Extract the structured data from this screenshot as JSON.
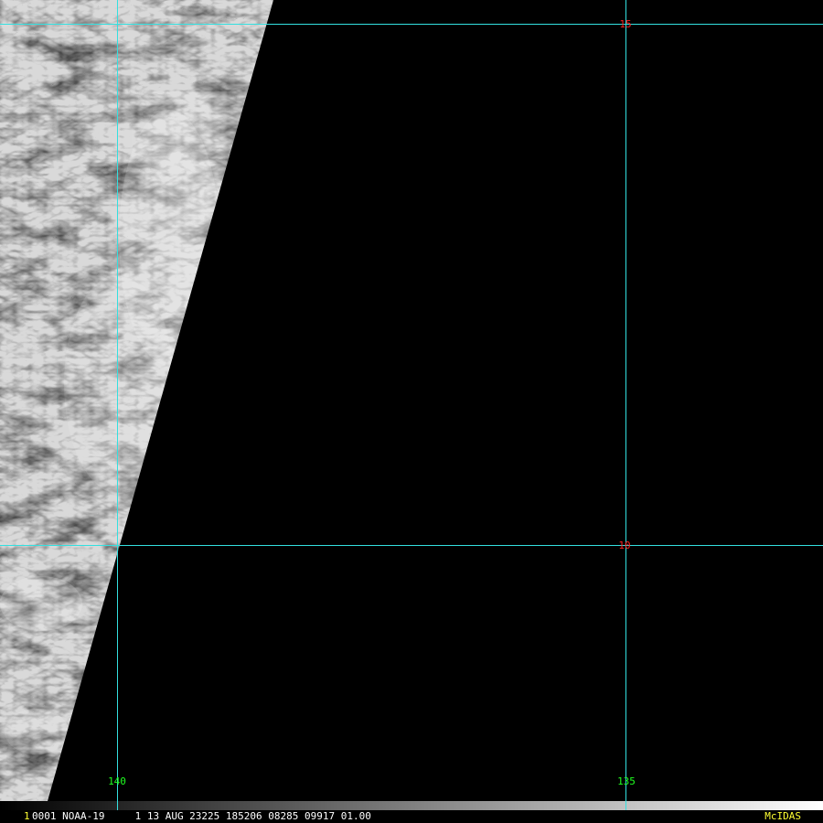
{
  "satellite_image": {
    "description_name": "cloud-imagery",
    "colors": {
      "background": "#000000",
      "gridline": "#33e0e0",
      "lat_label": "#ff2020",
      "lon_label": "#20ff20"
    }
  },
  "grid": {
    "latitudes": [
      {
        "label": "15"
      },
      {
        "label": "10"
      }
    ],
    "longitudes": [
      {
        "label": "140"
      },
      {
        "label": "135"
      }
    ]
  },
  "status": {
    "frame_number": "1",
    "info": "0001 NOAA-19     1 13 AUG 23225 185206 08285 09917 01.00",
    "brand": "McIDAS",
    "brand_color": "#ffff33"
  }
}
